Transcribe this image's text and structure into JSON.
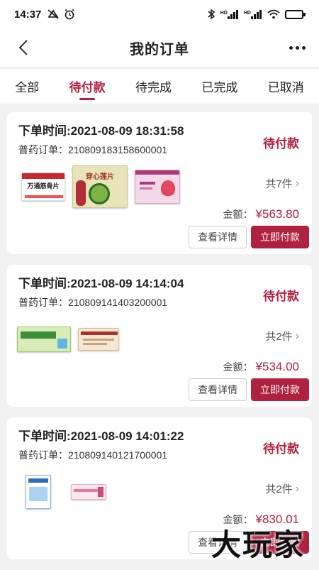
{
  "status_bar": {
    "time": "14:37",
    "hd1": "HD",
    "hd2": "HD"
  },
  "header": {
    "title": "我的订单"
  },
  "tabs": [
    {
      "label": "全部"
    },
    {
      "label": "待付款",
      "active": true
    },
    {
      "label": "待完成"
    },
    {
      "label": "已完成"
    },
    {
      "label": "已取消"
    }
  ],
  "orders": [
    {
      "time_label": "下单时间:2021-08-09 18:31:58",
      "order_no": "普药订单：210809183158600001",
      "status": "待付款",
      "count": "共7件",
      "amount_label": "金额：",
      "amount": "¥563.80",
      "detail_label": "查看详情",
      "pay_label": "立即付款",
      "products": [
        {
          "name": "万通筋骨片"
        },
        {
          "name": "穿心莲片"
        },
        {
          "name": "product-3"
        }
      ]
    },
    {
      "time_label": "下单时间:2021-08-09 14:14:04",
      "order_no": "普药订单：210809141403200001",
      "status": "待付款",
      "count": "共2件",
      "amount_label": "金额：",
      "amount": "¥534.00",
      "detail_label": "查看详情",
      "pay_label": "立即付款",
      "products": [
        {
          "name": "product-1"
        },
        {
          "name": "product-2"
        }
      ]
    },
    {
      "time_label": "下单时间:2021-08-09 14:01:22",
      "order_no": "普药订单：210809140121700001",
      "status": "待付款",
      "count": "共2件",
      "amount_label": "金额：",
      "amount": "¥830.01",
      "detail_label": "查看详情",
      "pay_label": "立即付款",
      "products": [
        {
          "name": "product-1"
        },
        {
          "name": "product-2"
        }
      ]
    }
  ],
  "watermark": "大玩家",
  "colors": {
    "accent": "#b0213f",
    "background": "#f1f1f1"
  }
}
